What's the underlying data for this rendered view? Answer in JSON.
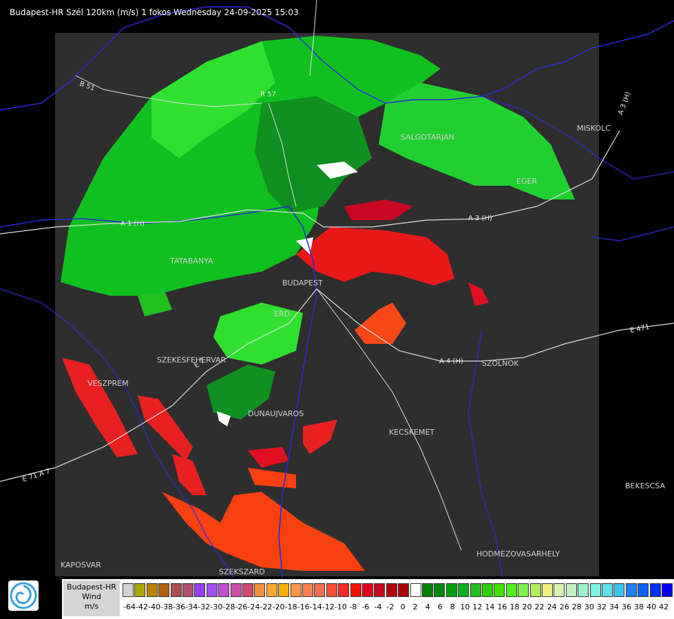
{
  "header": {
    "title": "Budapest-HR Szél 120km (m/s) 1 fokos Wednesday 24-09-2025 15:03"
  },
  "map": {
    "cities": [
      {
        "id": "salgotarjan",
        "label": "SALGOTARJAN"
      },
      {
        "id": "miskolc",
        "label": "MISKOLC"
      },
      {
        "id": "eger",
        "label": "EGER"
      },
      {
        "id": "tatabanya",
        "label": "TATABANYA"
      },
      {
        "id": "budapest",
        "label": "BUDAPEST"
      },
      {
        "id": "erd",
        "label": "ERD"
      },
      {
        "id": "szekesfehervar",
        "label": "SZEKESFEHERVAR"
      },
      {
        "id": "veszprem",
        "label": "VESZPREM"
      },
      {
        "id": "dunaujvaros",
        "label": "DUNAUJVAROS"
      },
      {
        "id": "kecskemet",
        "label": "KECSKEMET"
      },
      {
        "id": "szolnok",
        "label": "SZOLNOK"
      },
      {
        "id": "bekescsaba",
        "label": "BEKESCSA"
      },
      {
        "id": "hodmezovasarhely",
        "label": "HODMEZOVASARHELY"
      },
      {
        "id": "kaposvar",
        "label": "KAPOSVAR"
      },
      {
        "id": "szekszard",
        "label": "SZEKSZARD"
      }
    ],
    "roads": [
      {
        "id": "b51",
        "label": "B 51"
      },
      {
        "id": "r57",
        "label": "R 57"
      },
      {
        "id": "a3h",
        "label": "A 3 (H)"
      },
      {
        "id": "a3h-ne",
        "label": "A 3 (H)"
      },
      {
        "id": "a4h",
        "label": "A 4 (H)"
      },
      {
        "id": "e471",
        "label": "E 471"
      },
      {
        "id": "e71",
        "label": "E 71 A 7"
      },
      {
        "id": "a1h",
        "label": "A 1 (H)"
      },
      {
        "id": "e73",
        "label": "E 7"
      }
    ],
    "colors": {
      "background": "#000000",
      "radar_area": "#2e2e2e",
      "boundary": "#2a2ad8",
      "road": "#e0e0e0",
      "city": "#cfcfcf"
    }
  },
  "legend": {
    "title_lines": [
      "Budapest-HR",
      "Wind",
      "m/s"
    ],
    "colors": [
      "#d3d3d3",
      "#a8a800",
      "#b88400",
      "#b06010",
      "#a85050",
      "#b05070",
      "#9040f0",
      "#a050f0",
      "#c050d0",
      "#c850a8",
      "#d04870",
      "#f09040",
      "#f8a830",
      "#f8b000",
      "#f89848",
      "#f88050",
      "#f07050",
      "#f85030",
      "#f82828",
      "#f81000",
      "#e00020",
      "#c80820",
      "#b00808",
      "#a80000",
      "#ffffff",
      "#008000",
      "#008810",
      "#00a010",
      "#10b020",
      "#20c020",
      "#30d000",
      "#40e000",
      "#50f020",
      "#80f050",
      "#b0f060",
      "#f0f080",
      "#d8f0b0",
      "#c0f0c0",
      "#a0f0d0",
      "#80f0e0",
      "#60e0f0",
      "#40c0f0",
      "#2080f0",
      "#1060f0",
      "#0030f0",
      "#0000f0"
    ],
    "tick_labels": [
      "-64",
      "-42",
      "-40",
      "-38",
      "-36",
      "-34",
      "-32",
      "-30",
      "-28",
      "-26",
      "-24",
      "-22",
      "-20",
      "-18",
      "-16",
      "-14",
      "-12",
      "-10",
      "-8",
      "-6",
      "-4",
      "-2",
      "0",
      "2",
      "4",
      "6",
      "8",
      "10",
      "12",
      "14",
      "16",
      "18",
      "20",
      "22",
      "24",
      "26",
      "28",
      "30",
      "32",
      "34",
      "36",
      "38",
      "40",
      "42"
    ]
  }
}
